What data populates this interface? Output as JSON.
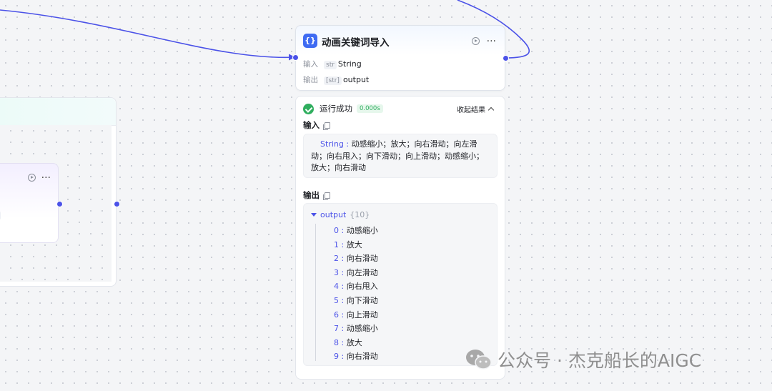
{
  "node": {
    "title": "动画关键词导入",
    "input_label": "输入",
    "input_type": "str",
    "input_name": "String",
    "output_label": "输出",
    "output_type": "[str]",
    "output_name": "output"
  },
  "left_node": {
    "fragment_text": "t"
  },
  "result": {
    "status": "运行成功",
    "time": "0.000s",
    "collapse_label": "收起结果",
    "input_title": "输入",
    "input_key": "String",
    "input_sep": " : ",
    "input_value": "动感缩小；放大；向右滑动；向左滑动；向右甩入；向下滑动；向上滑动；动感缩小；放大；向右滑动",
    "output_title": "输出",
    "output_key": "output",
    "output_count": "{10}",
    "output_items": [
      {
        "index": "0",
        "value": "动感缩小"
      },
      {
        "index": "1",
        "value": "放大"
      },
      {
        "index": "2",
        "value": "向右滑动"
      },
      {
        "index": "3",
        "value": "向左滑动"
      },
      {
        "index": "4",
        "value": "向右甩入"
      },
      {
        "index": "5",
        "value": "向下滑动"
      },
      {
        "index": "6",
        "value": "向上滑动"
      },
      {
        "index": "7",
        "value": "动感缩小"
      },
      {
        "index": "8",
        "value": "放大"
      },
      {
        "index": "9",
        "value": "向右滑动"
      }
    ]
  },
  "watermark": {
    "text": "公众号 · 杰克船长的AIGC"
  },
  "colors": {
    "accent": "#4b52e8",
    "success": "#2fae5e",
    "node_icon": "#3f6bf2"
  }
}
